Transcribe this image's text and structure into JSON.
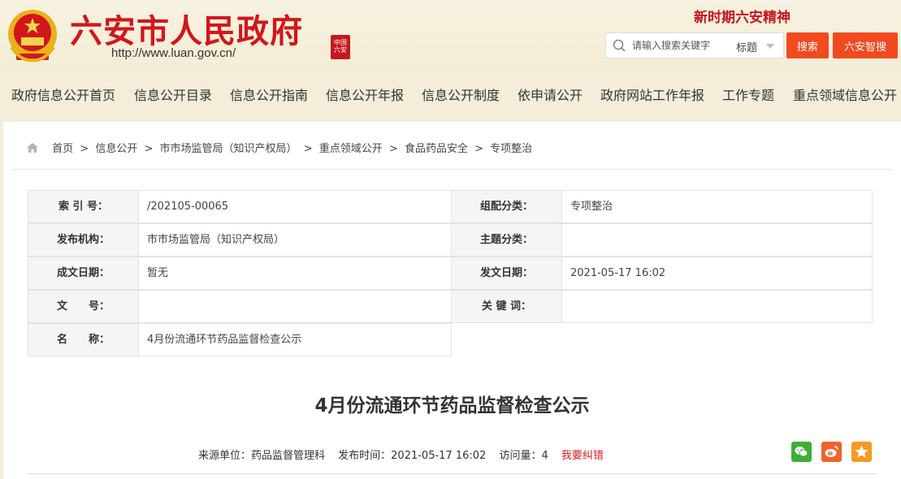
{
  "header": {
    "site_title": "六安市人民政府",
    "site_url": "http://www.luan.gov.cn/",
    "seal_text": "中国六安",
    "spirit_text": "新时期六安精神"
  },
  "search": {
    "placeholder": "请输入搜索关键字",
    "scope": "标题",
    "search_label": "搜索",
    "smart_label": "六安智搜"
  },
  "nav": {
    "items": [
      "政府信息公开首页",
      "信息公开目录",
      "信息公开指南",
      "信息公开年报",
      "信息公开制度",
      "依申请公开",
      "政府网站工作年报",
      "工作专题",
      "重点领域信息公开"
    ]
  },
  "breadcrumb": {
    "items": [
      "首页",
      "信息公开",
      "市市场监管局（知识产权局）",
      "重点领域公开",
      "食品药品安全",
      "专项整治"
    ],
    "sep": ">"
  },
  "meta": {
    "index_label": "索 引 号：",
    "index_value": "/202105-00065",
    "category_label": "组配分类：",
    "category_value": "专项整治",
    "publisher_label": "发布机构：",
    "publisher_value": "市市场监管局（知识产权局）",
    "topic_label": "主题分类：",
    "topic_value": "",
    "created_label": "成文日期：",
    "created_value": "暂无",
    "pubdate_label": "发文日期：",
    "pubdate_value": "2021-05-17 16:02",
    "docno_label": "文　　号：",
    "docno_value": "",
    "keywords_label": "关 键 词：",
    "keywords_value": "",
    "name_label": "名　　称：",
    "name_value": "4月份流通环节药品监督检查公示"
  },
  "article": {
    "title": "4月份流通环节药品监督检查公示",
    "source": "来源单位：药品监督管理科",
    "pubtime": "发布时间：2021-05-17 16:02",
    "visits": "访问量：4",
    "report": "我要纠错"
  },
  "colors": {
    "brand_red": "#d2161a",
    "button_orange": "#f04a1e",
    "wechat_green": "#3cb034",
    "weibo_orange": "#f0632d",
    "fav_orange": "#f59a23"
  }
}
